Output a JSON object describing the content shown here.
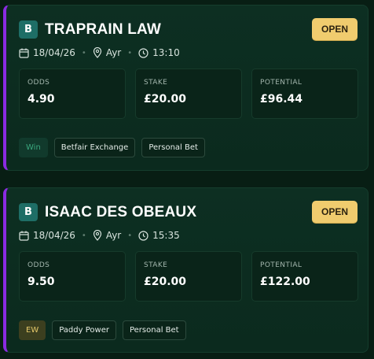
{
  "colors": {
    "background": "#081e14",
    "card": "#0d2f22",
    "accent_bar": "#8a2be2",
    "status_open": "#f0cc6e",
    "bookmaker_badge": "#1e6e66",
    "win_tag": "#3aa77e",
    "ew_tag": "#e6c96a"
  },
  "bets": [
    {
      "badge": "B",
      "horse": "TRAPRAIN LAW",
      "status": "OPEN",
      "date": "18/04/26",
      "course": "Ayr",
      "time": "13:10",
      "odds_label": "ODDS",
      "odds": "4.90",
      "stake_label": "STAKE",
      "stake": "£20.00",
      "potential_label": "POTENTIAL",
      "potential": "£96.44",
      "bet_type": "Win",
      "bookmaker": "Betfair Exchange",
      "category": "Personal Bet"
    },
    {
      "badge": "B",
      "horse": "ISAAC DES OBEAUX",
      "status": "OPEN",
      "date": "18/04/26",
      "course": "Ayr",
      "time": "15:35",
      "odds_label": "ODDS",
      "odds": "9.50",
      "stake_label": "STAKE",
      "stake": "£20.00",
      "potential_label": "POTENTIAL",
      "potential": "£122.00",
      "bet_type": "EW",
      "bookmaker": "Paddy Power",
      "category": "Personal Bet"
    }
  ],
  "icons": [
    "calendar-icon",
    "location-pin-icon",
    "clock-icon"
  ]
}
